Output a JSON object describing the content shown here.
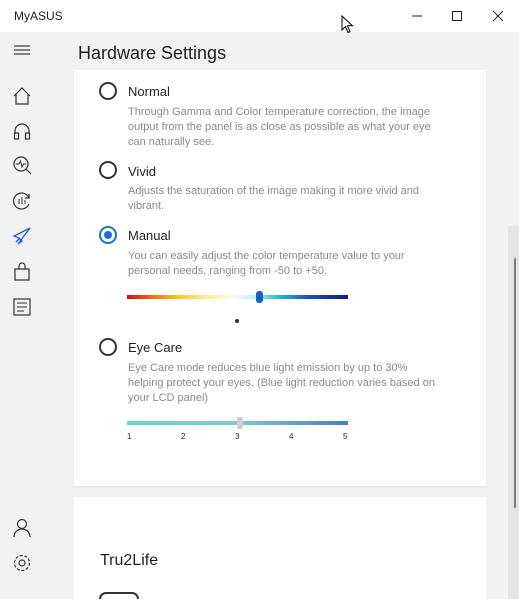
{
  "app": {
    "title": "MyASUS"
  },
  "window_controls": [
    "minimize-icon",
    "maximize-icon",
    "close-icon"
  ],
  "sidebar": {
    "items": [
      "menu-icon",
      "home-icon",
      "headset-icon",
      "diagnostics-icon",
      "system-update-icon",
      "rocket-icon",
      "store-icon",
      "news-icon"
    ],
    "bottom": [
      "user-icon",
      "settings-icon"
    ]
  },
  "page": {
    "title": "Hardware Settings"
  },
  "color_modes": {
    "options": [
      {
        "label": "Normal",
        "description": "Through Gamma and Color temperature correction, the image output from the panel is as close as possible as what your eye can naturally see.",
        "selected": false
      },
      {
        "label": "Vivid",
        "description": "Adjusts the saturation of the image making it more vivid and vibrant.",
        "selected": false
      },
      {
        "label": "Manual",
        "description": "You can easily adjust the color temperature value to your personal needs, ranging from -50 to +50.",
        "selected": true
      },
      {
        "label": "Eye Care",
        "description": "Eye Care mode reduces blue light emission by up to 30% helping protect your eyes. (Blue light reduction varies based on your LCD panel)",
        "selected": false
      }
    ],
    "manual_slider": {
      "min": -50,
      "max": 50,
      "value": 10
    },
    "eye_care_slider": {
      "ticks": [
        "1",
        "2",
        "3",
        "4",
        "5"
      ],
      "value": 3
    }
  },
  "tru2life": {
    "title": "Tru2Life"
  },
  "colors": {
    "accent": "#1e6fd9",
    "sidebar_bg": "#f2f2f2",
    "card_bg": "#ffffff"
  }
}
